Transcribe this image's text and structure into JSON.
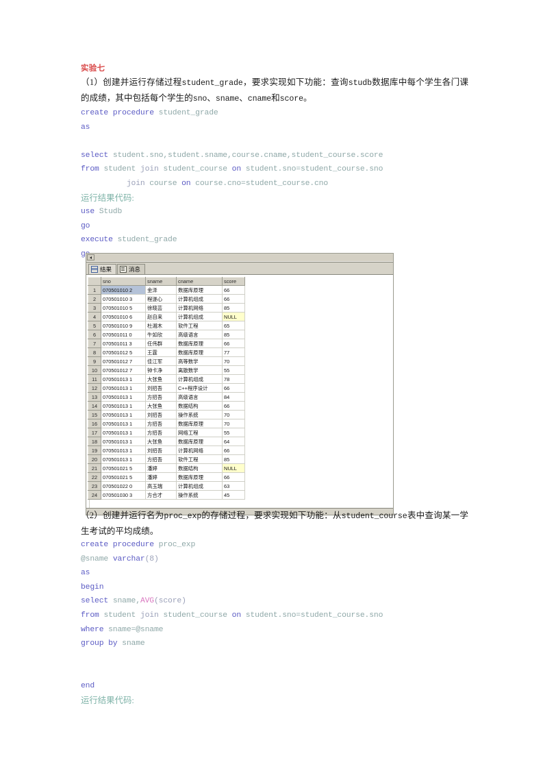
{
  "document": {
    "title": "实验七",
    "title_color": "#d94a4a"
  },
  "section1": {
    "paragraph_prefix": "（1）创建并运行存储过程",
    "paragraph_mono1": "student_grade",
    "paragraph_mid1": "，要求实现如下功能：查询",
    "paragraph_mono2": "studb",
    "paragraph_mid2": "数据库中每个学生各门课的成绩，其中包括每个学生的",
    "paragraph_mono3": "sno",
    "paragraph_sep1": "、",
    "paragraph_mono4": "sname",
    "paragraph_sep2": "、",
    "paragraph_mono5": "cname",
    "paragraph_mid3": "和",
    "paragraph_mono6": "score",
    "paragraph_end": "。",
    "code": [
      {
        "segments": [
          {
            "t": "create procedure ",
            "c": "kw"
          },
          {
            "t": "student_grade",
            "c": "id"
          }
        ]
      },
      {
        "segments": [
          {
            "t": "as",
            "c": "kw"
          }
        ]
      },
      {
        "segments": [
          {
            "t": "",
            "c": "plain"
          }
        ]
      },
      {
        "segments": [
          {
            "t": "select ",
            "c": "kw"
          },
          {
            "t": "student.sno,student.sname,course.cname,student_course.score",
            "c": "id"
          }
        ]
      },
      {
        "segments": [
          {
            "t": "from ",
            "c": "kw"
          },
          {
            "t": "student ",
            "c": "id"
          },
          {
            "t": "join ",
            "c": "plain"
          },
          {
            "t": "student_course ",
            "c": "id"
          },
          {
            "t": "on ",
            "c": "kw"
          },
          {
            "t": "student.sno=student_course.sno",
            "c": "id"
          }
        ]
      },
      {
        "segments": [
          {
            "t": "          join ",
            "c": "plain"
          },
          {
            "t": "course ",
            "c": "id"
          },
          {
            "t": "on ",
            "c": "kw"
          },
          {
            "t": "course.cno=student_course.cno",
            "c": "id"
          }
        ]
      }
    ],
    "run_label": "运行结果代码:",
    "run_code": [
      {
        "segments": [
          {
            "t": "use ",
            "c": "kw"
          },
          {
            "t": "Studb",
            "c": "id"
          }
        ]
      },
      {
        "segments": [
          {
            "t": "go",
            "c": "kw"
          }
        ]
      },
      {
        "segments": [
          {
            "t": "execute ",
            "c": "kw"
          },
          {
            "t": "student_grade",
            "c": "id"
          }
        ]
      },
      {
        "segments": [
          {
            "t": "go",
            "c": "kw"
          }
        ]
      }
    ]
  },
  "result_window": {
    "tabs": [
      {
        "label": "结果",
        "icon": "grid-icon",
        "active": true
      },
      {
        "label": "消息",
        "icon": "message-icon",
        "active": false
      }
    ],
    "columns": [
      "",
      "sno",
      "sname",
      "cname",
      "score"
    ],
    "rows": [
      {
        "no": "1",
        "sno": "070501010 2",
        "sname": "金泽",
        "cname": "数据库原理",
        "score": "66",
        "selected": true,
        "highlight": false
      },
      {
        "no": "2",
        "sno": "070501010 3",
        "sname": "程遂心",
        "cname": "计算机组成",
        "score": "66",
        "selected": false,
        "highlight": false
      },
      {
        "no": "3",
        "sno": "070501010 5",
        "sname": "徐晓芸",
        "cname": "计算机网络",
        "score": "85",
        "selected": false,
        "highlight": false
      },
      {
        "no": "4",
        "sno": "070501010 6",
        "sname": "赵自来",
        "cname": "计算机组成",
        "score": "NULL",
        "selected": false,
        "highlight": true
      },
      {
        "no": "5",
        "sno": "070501010 9",
        "sname": "杜湘木",
        "cname": "软件工程",
        "score": "65",
        "selected": false,
        "highlight": false
      },
      {
        "no": "6",
        "sno": "070501011 0",
        "sname": "牛如欣",
        "cname": "高级语言",
        "score": "85",
        "selected": false,
        "highlight": false
      },
      {
        "no": "7",
        "sno": "070501011 3",
        "sname": "任伟群",
        "cname": "数据库原理",
        "score": "66",
        "selected": false,
        "highlight": false
      },
      {
        "no": "8",
        "sno": "070501012 5",
        "sname": "王霆",
        "cname": "数据库原理",
        "score": "77",
        "selected": false,
        "highlight": false
      },
      {
        "no": "9",
        "sno": "070501012 7",
        "sname": "佳江军",
        "cname": "高等数学",
        "score": "70",
        "selected": false,
        "highlight": false
      },
      {
        "no": "10",
        "sno": "070501012 7",
        "sname": "钟卡净",
        "cname": "离散数学",
        "score": "55",
        "selected": false,
        "highlight": false
      },
      {
        "no": "11",
        "sno": "070501013 1",
        "sname": "大张鱼",
        "cname": "计算机组成",
        "score": "78",
        "selected": false,
        "highlight": false
      },
      {
        "no": "12",
        "sno": "070501013 1",
        "sname": "刘招吾",
        "cname": "C++程序设计",
        "score": "66",
        "selected": false,
        "highlight": false
      },
      {
        "no": "13",
        "sno": "070501013 1",
        "sname": "方招吾",
        "cname": "高级语言",
        "score": "84",
        "selected": false,
        "highlight": false
      },
      {
        "no": "14",
        "sno": "070501013 1",
        "sname": "大张鱼",
        "cname": "数据结构",
        "score": "66",
        "selected": false,
        "highlight": false
      },
      {
        "no": "15",
        "sno": "070501013 1",
        "sname": "刘招吾",
        "cname": "操作系统",
        "score": "70",
        "selected": false,
        "highlight": false
      },
      {
        "no": "16",
        "sno": "070501013 1",
        "sname": "方招吾",
        "cname": "数据库原理",
        "score": "70",
        "selected": false,
        "highlight": false
      },
      {
        "no": "17",
        "sno": "070501013 1",
        "sname": "方招吾",
        "cname": "网络工程",
        "score": "55",
        "selected": false,
        "highlight": false
      },
      {
        "no": "18",
        "sno": "070501013 1",
        "sname": "大张鱼",
        "cname": "数据库原理",
        "score": "64",
        "selected": false,
        "highlight": false
      },
      {
        "no": "19",
        "sno": "070501013 1",
        "sname": "刘招吾",
        "cname": "计算机网络",
        "score": "66",
        "selected": false,
        "highlight": false
      },
      {
        "no": "20",
        "sno": "070501013 1",
        "sname": "方招吾",
        "cname": "软件工程",
        "score": "85",
        "selected": false,
        "highlight": false
      },
      {
        "no": "21",
        "sno": "070501021 5",
        "sname": "潘婷",
        "cname": "数据结构",
        "score": "NULL",
        "selected": false,
        "highlight": true
      },
      {
        "no": "22",
        "sno": "070501021 5",
        "sname": "潘婷",
        "cname": "数据库原理",
        "score": "66",
        "selected": false,
        "highlight": false
      },
      {
        "no": "23",
        "sno": "070501022 0",
        "sname": "高玉瑞",
        "cname": "计算机组成",
        "score": "63",
        "selected": false,
        "highlight": false
      },
      {
        "no": "24",
        "sno": "070501030 3",
        "sname": "方合才",
        "cname": "操作系统",
        "score": "45",
        "selected": false,
        "highlight": false
      }
    ]
  },
  "section2": {
    "paragraph_prefix": "（2）创建并运行名为",
    "paragraph_mono1": "proc_exp",
    "paragraph_mid1": "的存储过程，要求实现如下功能：从",
    "paragraph_mono2": "student_course",
    "paragraph_end": "表中查询某一学生考试的平均成绩。",
    "code": [
      {
        "segments": [
          {
            "t": "create procedure ",
            "c": "kw"
          },
          {
            "t": "proc_exp",
            "c": "id"
          }
        ]
      },
      {
        "segments": [
          {
            "t": "@sname ",
            "c": "id"
          },
          {
            "t": "varchar",
            "c": "kw"
          },
          {
            "t": "(8)",
            "c": "plain"
          }
        ]
      },
      {
        "segments": [
          {
            "t": "as",
            "c": "kw"
          }
        ]
      },
      {
        "segments": [
          {
            "t": "begin",
            "c": "kw"
          }
        ]
      },
      {
        "segments": [
          {
            "t": "select ",
            "c": "kw"
          },
          {
            "t": "sname,",
            "c": "id"
          },
          {
            "t": "AVG",
            "c": "fn"
          },
          {
            "t": "(score)",
            "c": "plain"
          }
        ]
      },
      {
        "segments": [
          {
            "t": "from ",
            "c": "kw"
          },
          {
            "t": "student ",
            "c": "id"
          },
          {
            "t": "join ",
            "c": "plain"
          },
          {
            "t": "student_course ",
            "c": "id"
          },
          {
            "t": "on ",
            "c": "kw"
          },
          {
            "t": "student.sno=student_course.sno",
            "c": "id"
          }
        ]
      },
      {
        "segments": [
          {
            "t": "where ",
            "c": "kw"
          },
          {
            "t": "sname=@sname",
            "c": "id"
          }
        ]
      },
      {
        "segments": [
          {
            "t": "group by ",
            "c": "kw"
          },
          {
            "t": "sname",
            "c": "id"
          }
        ]
      },
      {
        "segments": [
          {
            "t": "",
            "c": "plain"
          }
        ]
      },
      {
        "segments": [
          {
            "t": "",
            "c": "plain"
          }
        ]
      },
      {
        "segments": [
          {
            "t": "end",
            "c": "kw"
          }
        ]
      }
    ],
    "run_label": "运行结果代码:"
  }
}
